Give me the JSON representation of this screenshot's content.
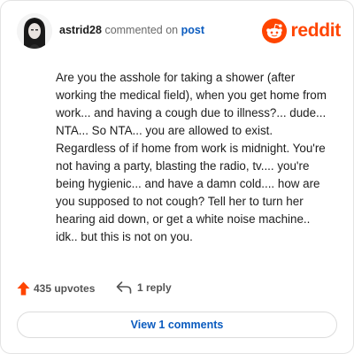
{
  "header": {
    "username": "astrid28",
    "action_text": "commented on",
    "post_link": "post",
    "brand": "reddit"
  },
  "comment": {
    "body": "Are you the asshole for taking a shower (after working the medical field), when you get home from work... and having a cough due to illness?... dude... NTA... So NTA... you are allowed to exist. Regardless of if home from work is midnight. You're not having a party, blasting the radio, tv.... you're being hygienic... and have a damn cold.... how are you supposed to not cough? Tell her to turn her hearing aid down, or get a white noise machine.. idk.. but this is not on you."
  },
  "actions": {
    "upvotes": "435 upvotes",
    "replies": "1 reply"
  },
  "footer": {
    "view_comments": "View 1 comments"
  },
  "icons": {
    "avatar": "avatar",
    "logo": "reddit-logo-icon",
    "upvote": "upvote-arrow-icon",
    "reply": "reply-arrow-icon"
  },
  "colors": {
    "brand_orange": "#ff4500",
    "link_blue": "#0a5bbf",
    "upvote_orange": "#ff4500",
    "muted_text": "#545454"
  }
}
